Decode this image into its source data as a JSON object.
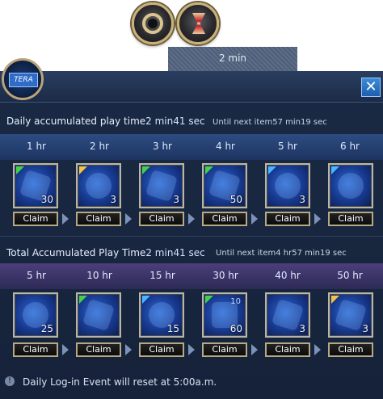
{
  "top": {
    "timer_text": "2 min"
  },
  "logo": {
    "text": "TERA"
  },
  "close": {
    "label": "✕"
  },
  "daily": {
    "title_prefix": "Daily accumulated play time",
    "elapsed": "2 min41 sec",
    "until_next": "Until next item57 min19 sec",
    "hours": [
      "1 hr",
      "2 hr",
      "3 hr",
      "4 hr",
      "5 hr",
      "6 hr"
    ],
    "items": [
      {
        "qty": "30",
        "corner": "green"
      },
      {
        "qty": "3",
        "corner": "gold"
      },
      {
        "qty": "3",
        "corner": "green"
      },
      {
        "qty": "50",
        "corner": "green"
      },
      {
        "qty": "3",
        "corner": "blue"
      },
      {
        "qty": "",
        "corner": "blue"
      }
    ],
    "claim_label": "Claim"
  },
  "total": {
    "title_prefix": "Total Accumulated Play Time",
    "elapsed": "2 min41 sec",
    "until_next": "Until next item4 hr57 min19 sec",
    "hours": [
      "5 hr",
      "10 hr",
      "15 hr",
      "30 hr",
      "40 hr",
      "50 hr"
    ],
    "items": [
      {
        "qty": "25",
        "corner": "none"
      },
      {
        "qty": "",
        "corner": "green"
      },
      {
        "qty": "15",
        "corner": "blue"
      },
      {
        "qty": "60",
        "corner": "green",
        "badge": "10"
      },
      {
        "qty": "3",
        "corner": "none"
      },
      {
        "qty": "3",
        "corner": "gold"
      }
    ],
    "claim_label": "Claim"
  },
  "footer": {
    "info": "!",
    "message": "Daily Log-in Event will reset at 5:00a.m."
  }
}
